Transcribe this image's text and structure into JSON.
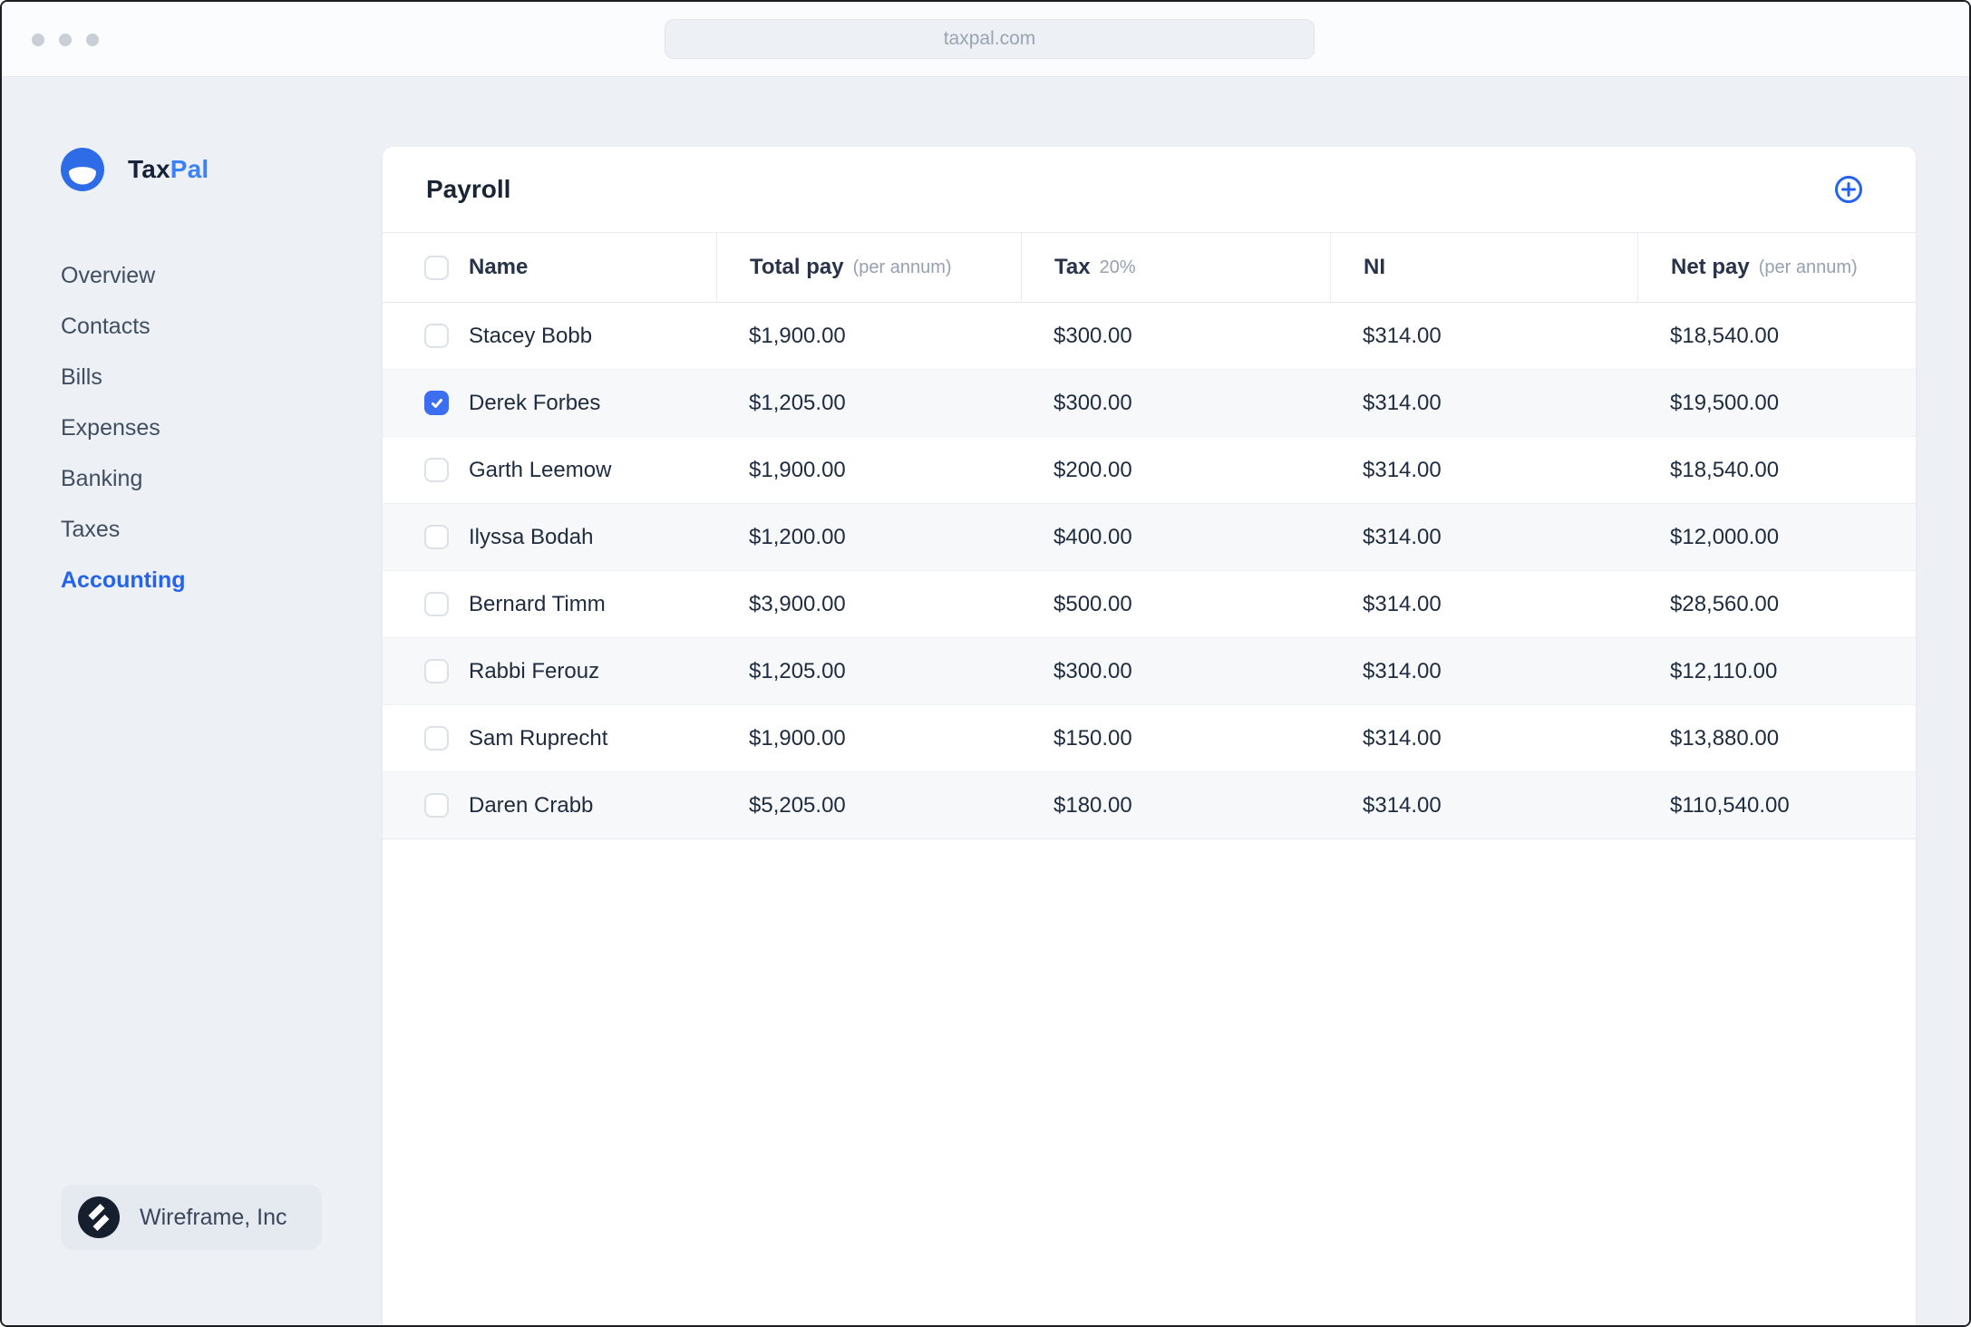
{
  "window": {
    "url": "taxpal.com"
  },
  "brand": {
    "name_primary": "Tax",
    "name_accent": "Pal"
  },
  "sidebar": {
    "nav": [
      {
        "label": "Overview",
        "active": false
      },
      {
        "label": "Contacts",
        "active": false
      },
      {
        "label": "Bills",
        "active": false
      },
      {
        "label": "Expenses",
        "active": false
      },
      {
        "label": "Banking",
        "active": false
      },
      {
        "label": "Taxes",
        "active": false
      },
      {
        "label": "Accounting",
        "active": true
      }
    ],
    "footer": {
      "company": "Wireframe, Inc"
    }
  },
  "payroll": {
    "title": "Payroll",
    "columns": [
      {
        "label": "Name",
        "note": ""
      },
      {
        "label": "Total pay",
        "note": "(per annum)"
      },
      {
        "label": "Tax",
        "note": "20%"
      },
      {
        "label": "NI",
        "note": ""
      },
      {
        "label": "Net pay",
        "note": "(per annum)"
      }
    ],
    "rows": [
      {
        "name": "Stacey Bobb",
        "total_pay": "$1,900.00",
        "tax": "$300.00",
        "ni": "$314.00",
        "net_pay": "$18,540.00",
        "checked": false
      },
      {
        "name": "Derek Forbes",
        "total_pay": "$1,205.00",
        "tax": "$300.00",
        "ni": "$314.00",
        "net_pay": "$19,500.00",
        "checked": true
      },
      {
        "name": "Garth Leemow",
        "total_pay": "$1,900.00",
        "tax": "$200.00",
        "ni": "$314.00",
        "net_pay": "$18,540.00",
        "checked": false
      },
      {
        "name": "Ilyssa Bodah",
        "total_pay": "$1,200.00",
        "tax": "$400.00",
        "ni": "$314.00",
        "net_pay": "$12,000.00",
        "checked": false
      },
      {
        "name": "Bernard Timm",
        "total_pay": "$3,900.00",
        "tax": "$500.00",
        "ni": "$314.00",
        "net_pay": "$28,560.00",
        "checked": false
      },
      {
        "name": "Rabbi Ferouz",
        "total_pay": "$1,205.00",
        "tax": "$300.00",
        "ni": "$314.00",
        "net_pay": "$12,110.00",
        "checked": false
      },
      {
        "name": "Sam Ruprecht",
        "total_pay": "$1,900.00",
        "tax": "$150.00",
        "ni": "$314.00",
        "net_pay": "$13,880.00",
        "checked": false
      },
      {
        "name": "Daren Crabb",
        "total_pay": "$5,205.00",
        "tax": "$180.00",
        "ni": "$314.00",
        "net_pay": "$110,540.00",
        "checked": false
      }
    ]
  },
  "colors": {
    "accent_blue": "#2563eb",
    "logo_blue": "#2e6be6",
    "checkbox_checked": "#3b6ff0",
    "page_bg": "#edf0f5",
    "card_bg": "#ffffff",
    "row_alt_bg": "#f6f8fa",
    "org_logo_bg": "#151f2e"
  }
}
